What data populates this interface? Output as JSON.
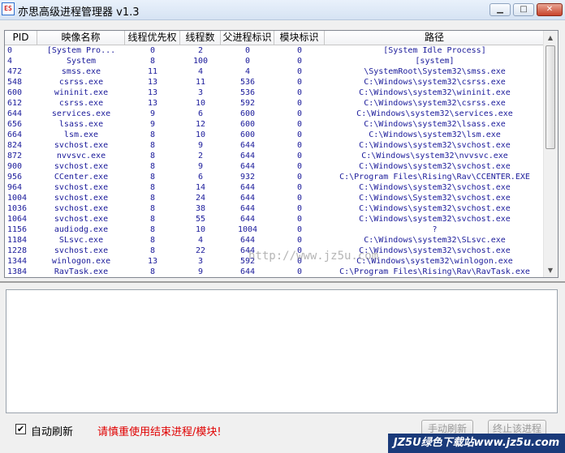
{
  "window": {
    "title": "亦思高级进程管理器 v1.3",
    "icon_text": "ES",
    "controls": [
      "▁",
      "□",
      "✕"
    ]
  },
  "table": {
    "columns": [
      "PID",
      "映像名称",
      "线程优先权",
      "线程数",
      "父进程标识",
      "模块标识",
      "路径"
    ],
    "rows": [
      [
        "0",
        "[System Pro...",
        "0",
        "2",
        "0",
        "0",
        "[System Idle Process]"
      ],
      [
        "4",
        "System",
        "8",
        "100",
        "0",
        "0",
        "[system]"
      ],
      [
        "472",
        "smss.exe",
        "11",
        "4",
        "4",
        "0",
        "\\SystemRoot\\System32\\smss.exe"
      ],
      [
        "548",
        "csrss.exe",
        "13",
        "11",
        "536",
        "0",
        "C:\\Windows\\system32\\csrss.exe"
      ],
      [
        "600",
        "wininit.exe",
        "13",
        "3",
        "536",
        "0",
        "C:\\Windows\\system32\\wininit.exe"
      ],
      [
        "612",
        "csrss.exe",
        "13",
        "10",
        "592",
        "0",
        "C:\\Windows\\system32\\csrss.exe"
      ],
      [
        "644",
        "services.exe",
        "9",
        "6",
        "600",
        "0",
        "C:\\Windows\\system32\\services.exe"
      ],
      [
        "656",
        "lsass.exe",
        "9",
        "12",
        "600",
        "0",
        "C:\\Windows\\system32\\lsass.exe"
      ],
      [
        "664",
        "lsm.exe",
        "8",
        "10",
        "600",
        "0",
        "C:\\Windows\\system32\\lsm.exe"
      ],
      [
        "824",
        "svchost.exe",
        "8",
        "9",
        "644",
        "0",
        "C:\\Windows\\system32\\svchost.exe"
      ],
      [
        "872",
        "nvvsvc.exe",
        "8",
        "2",
        "644",
        "0",
        "C:\\Windows\\system32\\nvvsvc.exe"
      ],
      [
        "900",
        "svchost.exe",
        "8",
        "9",
        "644",
        "0",
        "C:\\Windows\\system32\\svchost.exe"
      ],
      [
        "956",
        "CCenter.exe",
        "8",
        "6",
        "932",
        "0",
        "C:\\Program Files\\Rising\\Rav\\CCENTER.EXE"
      ],
      [
        "964",
        "svchost.exe",
        "8",
        "14",
        "644",
        "0",
        "C:\\Windows\\system32\\svchost.exe"
      ],
      [
        "1004",
        "svchost.exe",
        "8",
        "24",
        "644",
        "0",
        "C:\\Windows\\System32\\svchost.exe"
      ],
      [
        "1036",
        "svchost.exe",
        "8",
        "38",
        "644",
        "0",
        "C:\\Windows\\system32\\svchost.exe"
      ],
      [
        "1064",
        "svchost.exe",
        "8",
        "55",
        "644",
        "0",
        "C:\\Windows\\system32\\svchost.exe"
      ],
      [
        "1156",
        "audiodg.exe",
        "8",
        "10",
        "1004",
        "0",
        "?"
      ],
      [
        "1184",
        "SLsvc.exe",
        "8",
        "4",
        "644",
        "0",
        "C:\\Windows\\system32\\SLsvc.exe"
      ],
      [
        "1228",
        "svchost.exe",
        "8",
        "22",
        "644",
        "0",
        "C:\\Windows\\system32\\svchost.exe"
      ],
      [
        "1344",
        "winlogon.exe",
        "13",
        "3",
        "592",
        "0",
        "C:\\Windows\\system32\\winlogon.exe"
      ],
      [
        "1384",
        "RavTask.exe",
        "8",
        "9",
        "644",
        "0",
        "C:\\Program Files\\Rising\\Rav\\RavTask.exe"
      ]
    ]
  },
  "watermark": "http://www.jz5u.com",
  "footer": {
    "auto_refresh_label": "自动刷新",
    "auto_refresh_checked": true,
    "warning": "请慎重使用结束进程/模块!",
    "refresh_button": "手动刷新",
    "end_button": "终止该进程"
  },
  "promo": "JZ5U绿色下载站www.jz5u.com",
  "colors": {
    "table_text": "#1a1a9a",
    "warning": "#e00000"
  }
}
